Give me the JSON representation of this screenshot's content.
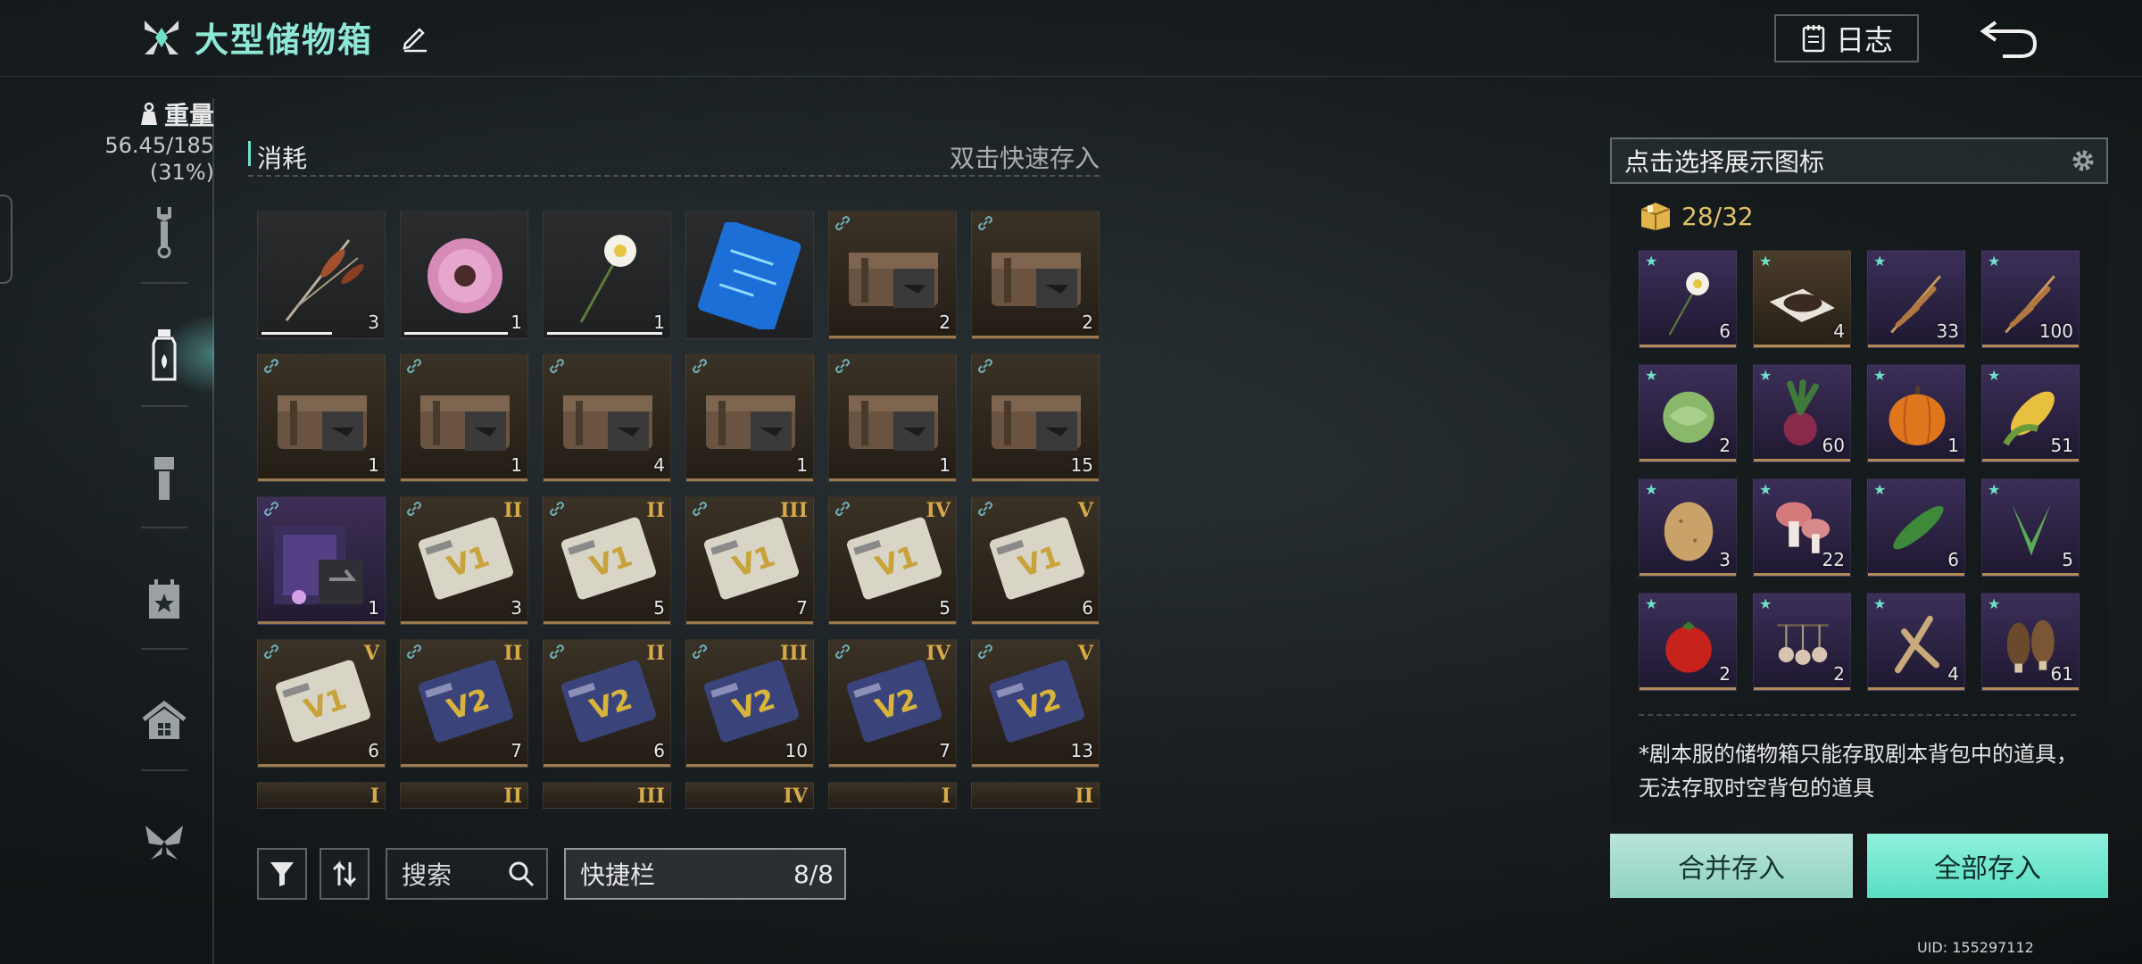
{
  "header": {
    "title": "大型储物箱",
    "log_label": "日志"
  },
  "weight": {
    "label": "重量",
    "value": "56.45/185",
    "percent": "(31%)"
  },
  "categories": [
    "wrench",
    "bottle",
    "flashlight",
    "calendar-star",
    "home",
    "butterfly"
  ],
  "section": {
    "title": "消耗",
    "hint": "双击快速存入"
  },
  "grid_items": [
    {
      "icon": "cattail",
      "count": "3",
      "durability": 0.58
    },
    {
      "icon": "pink-flower",
      "count": "1",
      "durability": 0.85
    },
    {
      "icon": "white-flower",
      "count": "1",
      "durability": 0.95
    },
    {
      "icon": "blue-chip-card",
      "count": ""
    },
    {
      "icon": "supply-chest",
      "count": "2",
      "linked": true
    },
    {
      "icon": "supply-chest",
      "count": "2",
      "linked": true
    },
    {
      "icon": "supply-chest",
      "count": "1",
      "linked": true
    },
    {
      "icon": "supply-chest",
      "count": "1",
      "linked": true
    },
    {
      "icon": "supply-chest",
      "count": "4",
      "linked": true
    },
    {
      "icon": "supply-chest",
      "count": "1",
      "linked": true
    },
    {
      "icon": "supply-chest",
      "count": "1",
      "linked": true
    },
    {
      "icon": "supply-chest",
      "count": "15",
      "linked": true
    },
    {
      "icon": "purple-crate",
      "count": "1",
      "linked": true
    },
    {
      "icon": "v1-card",
      "count": "3",
      "tier": "II",
      "linked": true
    },
    {
      "icon": "v1-card",
      "count": "5",
      "tier": "II",
      "linked": true
    },
    {
      "icon": "v1-card",
      "count": "7",
      "tier": "III",
      "linked": true
    },
    {
      "icon": "v1-card",
      "count": "5",
      "tier": "IV",
      "linked": true
    },
    {
      "icon": "v1-card",
      "count": "6",
      "tier": "V",
      "linked": true
    },
    {
      "icon": "v1-card",
      "count": "6",
      "tier": "V",
      "linked": true
    },
    {
      "icon": "v2-card",
      "count": "7",
      "tier": "II",
      "linked": true
    },
    {
      "icon": "v2-card",
      "count": "6",
      "tier": "II",
      "linked": true
    },
    {
      "icon": "v2-card",
      "count": "10",
      "tier": "III",
      "linked": true
    },
    {
      "icon": "v2-card",
      "count": "7",
      "tier": "IV",
      "linked": true
    },
    {
      "icon": "v2-card",
      "count": "13",
      "tier": "V",
      "linked": true
    }
  ],
  "partial_tiers": [
    "I",
    "II",
    "III",
    "IV",
    "I",
    "II"
  ],
  "toolbar": {
    "search_placeholder": "搜索",
    "quickbar_label": "快捷栏",
    "quickbar_count": "8/8"
  },
  "right_panel": {
    "select_label": "点击选择展示图标",
    "capacity": "28/32",
    "items": [
      {
        "icon": "white-flower",
        "count": "6"
      },
      {
        "icon": "coffee-beans",
        "count": "4"
      },
      {
        "icon": "wheat",
        "count": "33"
      },
      {
        "icon": "wheat",
        "count": "100"
      },
      {
        "icon": "cabbage",
        "count": "2"
      },
      {
        "icon": "beet",
        "count": "60"
      },
      {
        "icon": "pumpkin",
        "count": "1"
      },
      {
        "icon": "corn",
        "count": "51"
      },
      {
        "icon": "potato",
        "count": "3"
      },
      {
        "icon": "mushroom",
        "count": "22"
      },
      {
        "icon": "cucumber",
        "count": "6"
      },
      {
        "icon": "aloe",
        "count": "5"
      },
      {
        "icon": "tomato",
        "count": "2"
      },
      {
        "icon": "garlic",
        "count": "2"
      },
      {
        "icon": "ginseng",
        "count": "4"
      },
      {
        "icon": "morel",
        "count": "61"
      }
    ],
    "note": "*剧本服的储物箱只能存取剧本背包中的道具，无法存取时空背包的道具",
    "merge_label": "合并存入",
    "all_label": "全部存入"
  },
  "uid": "UID: 155297112",
  "colors": {
    "accent": "#6fe0c8",
    "tier": "#d6a94a",
    "capacity": "#e0c068"
  }
}
